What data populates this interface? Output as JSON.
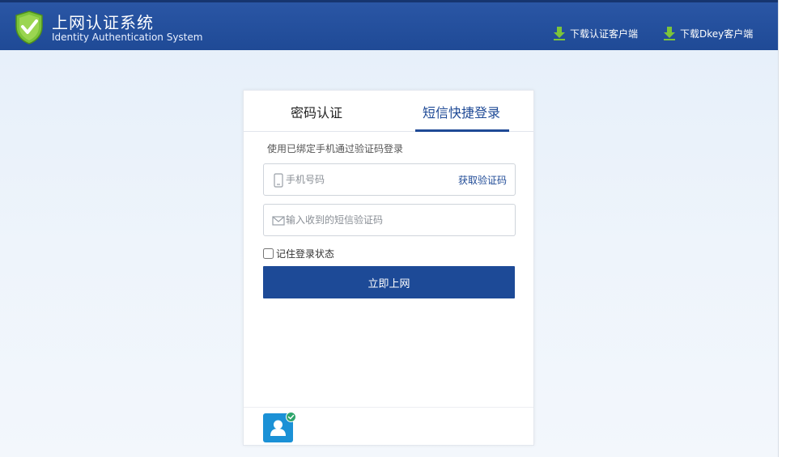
{
  "header": {
    "title_cn": "上网认证系统",
    "title_en": "Identity Authentication System",
    "logo_icon": "shield-check-icon",
    "background_color": "#2352a0",
    "downloads": [
      {
        "label": "下载认证客户端",
        "icon": "download-arrow-icon"
      },
      {
        "label": "下载Dkey客户端",
        "icon": "download-arrow-icon"
      }
    ]
  },
  "tabs": [
    {
      "label": "密码认证",
      "active": false
    },
    {
      "label": "短信快捷登录",
      "active": true
    }
  ],
  "form": {
    "hint": "使用已绑定手机通过验证码登录",
    "phone_placeholder": "手机号码",
    "phone_value": "",
    "phone_icon": "mobile-phone-icon",
    "get_code_label": "获取验证码",
    "code_placeholder": "输入收到的短信验证码",
    "code_value": "",
    "code_icon": "envelope-icon",
    "remember_label": "记住登录状态",
    "remember_checked": false,
    "submit_label": "立即上网"
  },
  "footer": {
    "avatar_icon": "user-avatar-icon",
    "badge_icon": "check-badge-icon"
  },
  "colors": {
    "primary": "#1d4a97",
    "accent_green": "#6fbf2a",
    "avatar_blue": "#1b91d6",
    "badge_green": "#2ea56b"
  }
}
